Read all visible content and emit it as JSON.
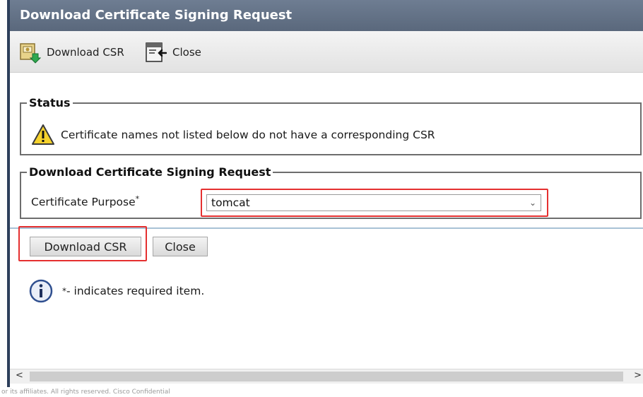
{
  "window": {
    "title": "Download Certificate Signing Request"
  },
  "toolbar": {
    "download_label": "Download CSR",
    "close_label": "Close"
  },
  "status": {
    "legend": "Status",
    "message": "Certificate names not listed below do not have a corresponding CSR"
  },
  "download_section": {
    "legend": "Download Certificate Signing Request",
    "purpose_label": "Certificate Purpose",
    "required_mark": "*",
    "purpose_value": "tomcat"
  },
  "buttons": {
    "download_label": "Download CSR",
    "close_label": "Close"
  },
  "info": {
    "required_marker": "*",
    "required_text": "- indicates required item."
  },
  "footer": {
    "text": "or its affiliates. All rights reserved.   Cisco Confidential"
  },
  "colors": {
    "title_bar": "#5a687c",
    "highlight_red": "#e53030",
    "divider_blue": "#a8c2d6"
  },
  "icons": {
    "toolbar_download": "download-csr-icon",
    "toolbar_close": "close-window-icon",
    "status": "warning-icon",
    "info": "info-icon"
  }
}
